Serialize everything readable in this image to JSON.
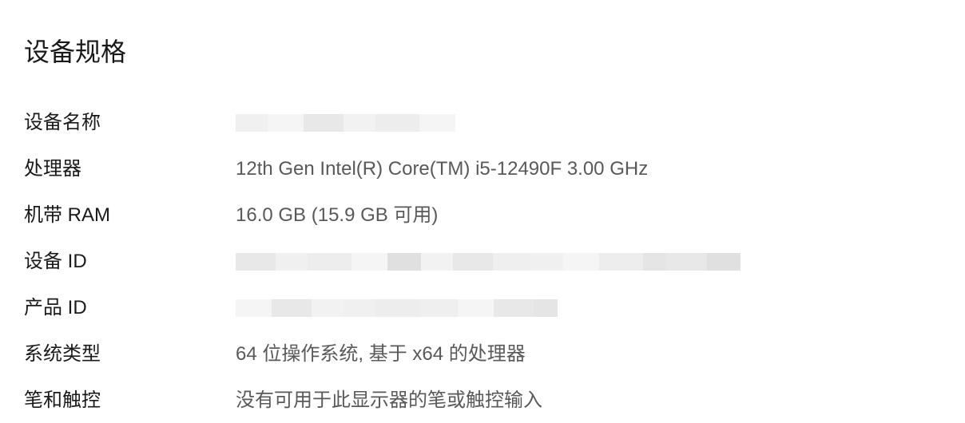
{
  "section_title": "设备规格",
  "specs": {
    "device_name": {
      "label": "设备名称",
      "value": ""
    },
    "processor": {
      "label": "处理器",
      "value": "12th Gen Intel(R) Core(TM) i5-12490F   3.00 GHz"
    },
    "ram": {
      "label": "机带 RAM",
      "value": "16.0 GB (15.9 GB 可用)"
    },
    "device_id": {
      "label": "设备 ID",
      "value": ""
    },
    "product_id": {
      "label": "产品 ID",
      "value": ""
    },
    "system_type": {
      "label": "系统类型",
      "value": "64 位操作系统, 基于 x64 的处理器"
    },
    "pen_touch": {
      "label": "笔和触控",
      "value": "没有可用于此显示器的笔或触控输入"
    }
  }
}
